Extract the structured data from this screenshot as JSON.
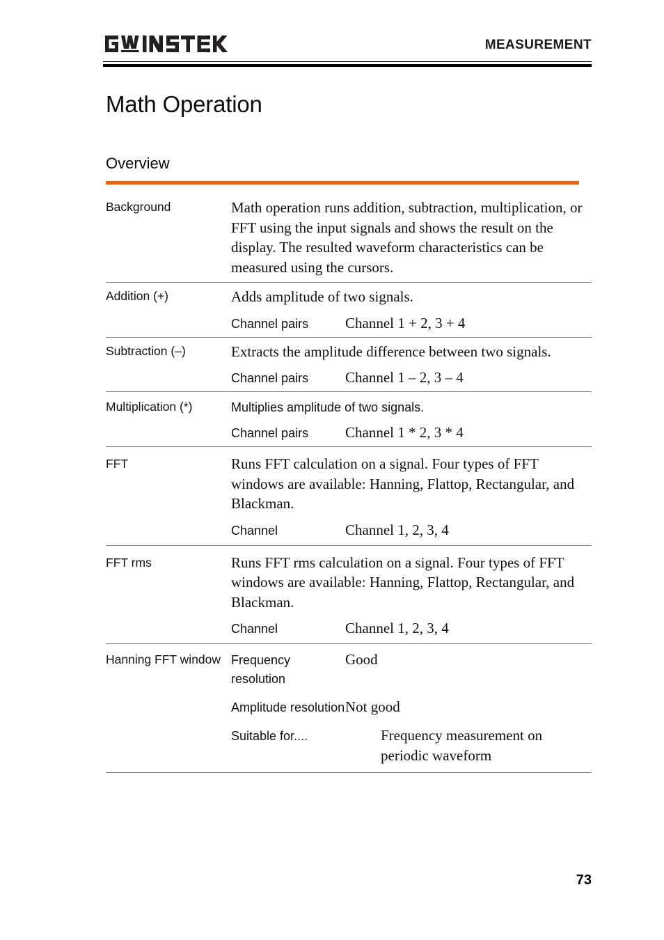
{
  "header": {
    "logo_text": "GW INSTEK",
    "logo_name": "gw-instek-logo",
    "section_title": "MEASUREMENT"
  },
  "page_title": "Math Operation",
  "section": {
    "heading": "Overview",
    "rule_color": "#E8621A"
  },
  "table": {
    "rows": [
      {
        "label": "Background",
        "description": "Math operation runs addition, subtraction, multiplication, or FFT using the input signals and shows the result on the display. The resulted waveform characteristics can be measured using the cursors."
      },
      {
        "label": "Addition (+)",
        "description": "Adds amplitude of two signals.",
        "sub_key": "Channel pairs",
        "sub_value": "Channel 1 + 2, 3 + 4"
      },
      {
        "label": "Subtraction (–)",
        "description": "Extracts the amplitude difference between two signals.",
        "sub_key": "Channel pairs",
        "sub_value": "Channel 1 – 2, 3 – 4"
      },
      {
        "label": "Multiplication (*)",
        "description": "Multiplies amplitude of two signals.",
        "sub_key": "Channel pairs",
        "sub_value": "Channel 1 * 2, 3 * 4"
      },
      {
        "label": "FFT",
        "description": "Runs FFT calculation on a signal. Four types of FFT windows are available: Hanning, Flattop, Rectangular, and Blackman.",
        "sub_key": "Channel",
        "sub_value": "Channel 1, 2, 3, 4"
      },
      {
        "label": "FFT rms",
        "description": "Runs FFT rms calculation on a signal. Four types of FFT windows are available: Hanning, Flattop, Rectangular, and Blackman.",
        "sub_key": "Channel",
        "sub_value": "Channel 1, 2, 3, 4"
      },
      {
        "label": "Hanning FFT window",
        "items": [
          {
            "key": "Frequency resolution",
            "value": "Good"
          },
          {
            "key": "Amplitude resolution",
            "value": "Not good"
          },
          {
            "key": "Suitable for....",
            "value": "Frequency measurement on periodic waveform"
          }
        ]
      }
    ]
  },
  "footer": {
    "page_number": "73"
  }
}
